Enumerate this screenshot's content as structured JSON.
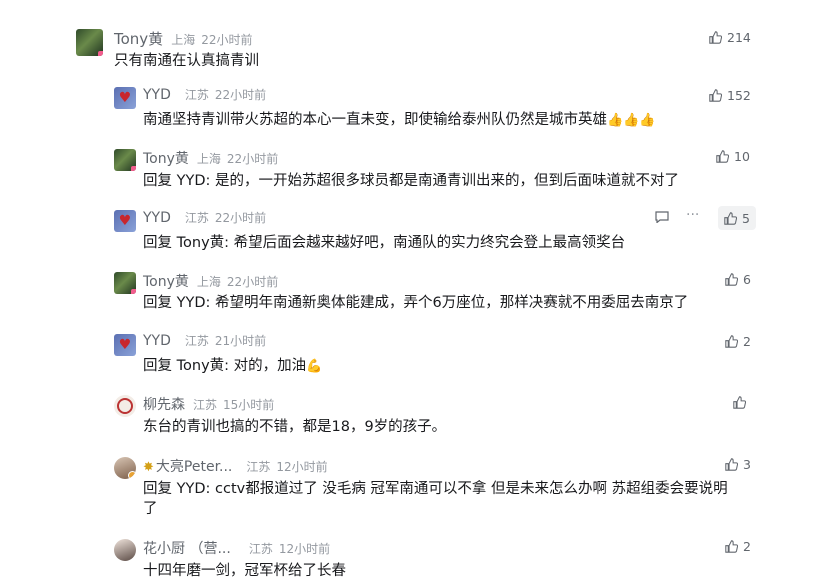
{
  "comments": [
    {
      "user": "Tony黄",
      "location": "上海",
      "time": "22小时前",
      "likes": "214",
      "prefix": "",
      "mention": "",
      "text": "只有南通在认真搞青训"
    },
    {
      "user": "YYD",
      "location": "江苏",
      "time": "22小时前",
      "likes": "152",
      "prefix": "",
      "mention": "",
      "text": "南通坚持青训带火苏超的本心一直未变，即使输给泰州队仍然是城市英雄",
      "emoji": "👍👍👍"
    },
    {
      "user": "Tony黄",
      "location": "上海",
      "time": "22小时前",
      "likes": "10",
      "prefix": "回复 ",
      "mention": "YYD",
      "text": ": 是的，一开始苏超很多球员都是南通青训出来的，但到后面味道就不对了"
    },
    {
      "user": "YYD",
      "location": "江苏",
      "time": "22小时前",
      "likes": "5",
      "prefix": "回复 ",
      "mention": "Tony黄",
      "text": ": 希望后面会越来越好吧，南通队的实力终究会登上最高领奖台"
    },
    {
      "user": "Tony黄",
      "location": "上海",
      "time": "22小时前",
      "likes": "6",
      "prefix": "回复 ",
      "mention": "YYD",
      "text": ": 希望明年南通新奥体能建成，弄个6万座位，那样决赛就不用委屈去南京了"
    },
    {
      "user": "YYD",
      "location": "江苏",
      "time": "21小时前",
      "likes": "2",
      "prefix": "回复 ",
      "mention": "Tony黄",
      "text": ": 对的，加油",
      "emoji": "💪"
    },
    {
      "user": "柳先森",
      "location": "江苏",
      "time": "15小时前",
      "likes": "",
      "prefix": "",
      "mention": "",
      "text": "东台的青训也搞的不错，都是18，9岁的孩子。"
    },
    {
      "user": "大亮Peter...",
      "location": "江苏",
      "time": "12小时前",
      "likes": "3",
      "prefix": "回复 ",
      "mention": "YYD",
      "text": ": cctv都报道过了 没毛病 冠军南通可以不拿 但是未来怎么办啊 苏超组委会要说明",
      "text2": "了"
    },
    {
      "user": "花小厨 （营...",
      "location": "江苏",
      "time": "12小时前",
      "likes": "2",
      "prefix": "",
      "mention": "",
      "text": "十四年磨一剑，冠军杯给了长春"
    }
  ],
  "icons": {
    "like": "thumbs-up-icon",
    "reply": "chat-bubble-icon",
    "more": "more-dots-icon"
  }
}
